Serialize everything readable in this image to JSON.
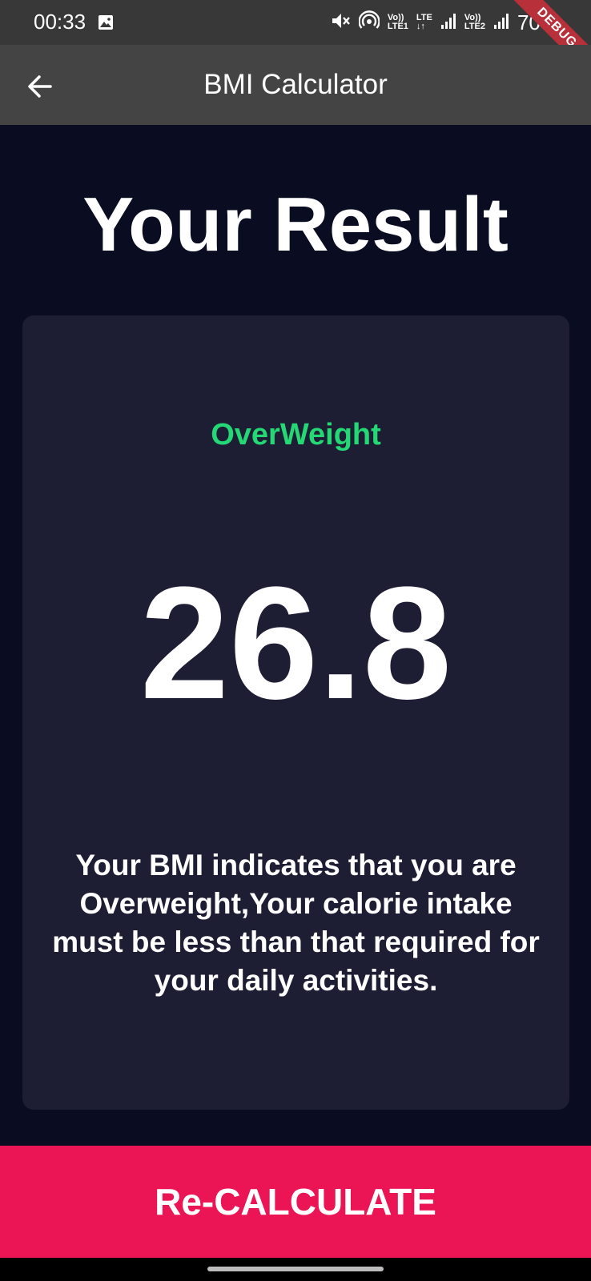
{
  "status_bar": {
    "time": "00:33",
    "battery": "70%",
    "sim1_top": "Vo))",
    "sim1_bottom": "LTE1",
    "net_top": "LTE",
    "net_bottom": "↓↑",
    "sim2_top": "Vo))",
    "sim2_bottom": "LTE2",
    "icons": [
      "gallery-icon",
      "mute-icon",
      "hotspot-icon",
      "signal-icon",
      "signal-icon"
    ]
  },
  "debug_banner": "DEBUG",
  "app_bar": {
    "title": "BMI Calculator",
    "back_icon": "arrow-left-icon"
  },
  "result": {
    "heading": "Your Result",
    "category": "OverWeight",
    "bmi": "26.8",
    "advice": "Your BMI indicates that you are\nOverweight,Your calorie intake\nmust be less than that required for\nyour daily activities."
  },
  "actions": {
    "recalculate_label": "Re-CALCULATE"
  },
  "colors": {
    "background": "#0a0d22",
    "card": "#1d1e33",
    "category_green": "#24d876",
    "button_pink": "#eb1555",
    "app_bar": "#444444"
  }
}
